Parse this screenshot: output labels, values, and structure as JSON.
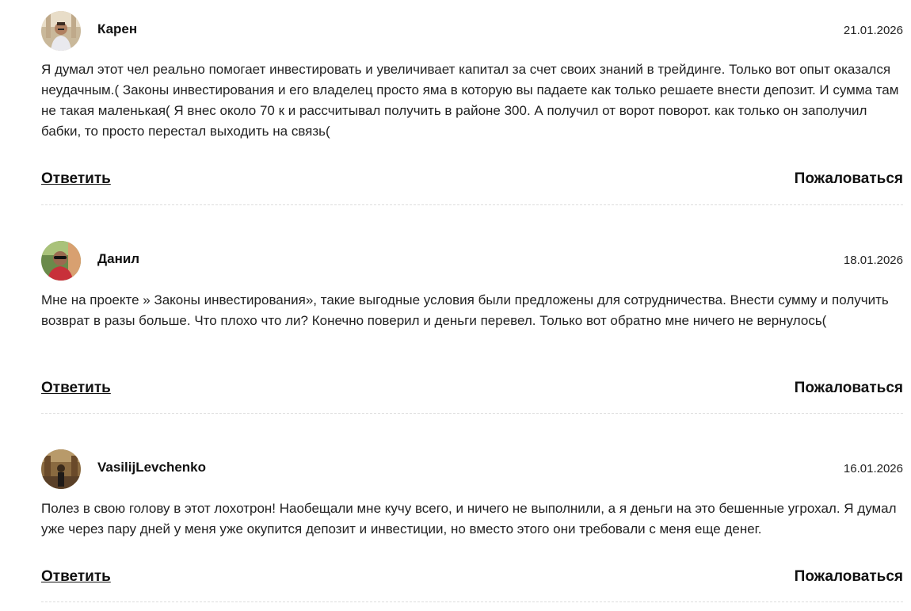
{
  "comments": [
    {
      "author": "Карен",
      "date": "21.01.2026",
      "text": "Я думал этот чел реально помогает инвестировать и увеличивает капитал за счет своих знаний в трейдинге. Только вот опыт оказался неудачным.( Законы инвестирования и его владелец просто яма в которую вы падаете как только решаете внести депозит. И сумма там не такая маленькая( Я внес около 70 к и рассчитывал получить в районе 300. А получил от ворот поворот. как только он заполучил бабки, то просто перестал выходить на связь(",
      "reply_label": "Ответить",
      "report_label": "Пожаловаться"
    },
    {
      "author": "Данил",
      "date": "18.01.2026",
      "text": "Мне на проекте » Законы инвестирования», такие выгодные условия были предложены для сотрудничества. Внести сумму и получить возврат в разы больше. Что плохо что ли? Конечно поверил и деньги перевел. Только вот обратно мне ничего не вернулось(",
      "reply_label": "Ответить",
      "report_label": "Пожаловаться"
    },
    {
      "author": "VasilijLevchenko",
      "date": "16.01.2026",
      "text": "Полез в свою голову в этот лохотрон! Наобещали мне кучу всего, и ничего не выполнили, а я деньги на это бешенные угрохал. Я думал уже через пару дней у меня уже окупится депозит и инвестиции, но вместо этого они требовали с меня еще денег.",
      "reply_label": "Ответить",
      "report_label": "Пожаловаться"
    }
  ]
}
